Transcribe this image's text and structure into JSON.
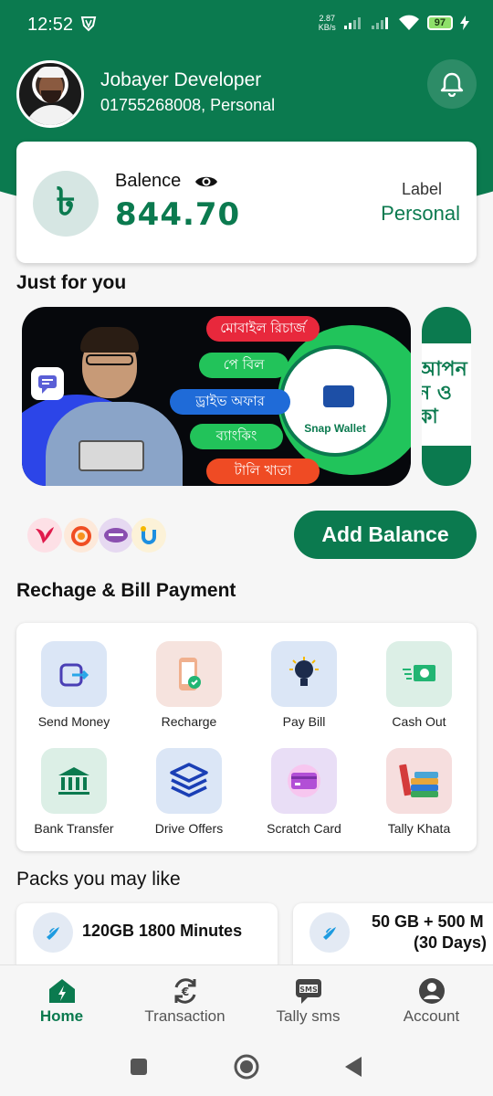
{
  "status_bar": {
    "time": "12:52",
    "net_speed_top": "2.87",
    "net_speed_bottom": "KB/s",
    "battery": "97"
  },
  "profile": {
    "name": "Jobayer Developer",
    "phone": "01755268008, Personal"
  },
  "balance": {
    "currency_symbol": "৳",
    "label": "Balence",
    "amount": "844.70",
    "account_label_title": "Label",
    "account_label_value": "Personal"
  },
  "sections": {
    "just_for_you": "Just for you",
    "recharge_bill": "Rechage & Bill Payment",
    "packs": "Packs you may like"
  },
  "banner": {
    "pills": [
      "মোবাইল রিচার্জ",
      "পে বিল",
      "ড্রাইভ অফার",
      "ব্যাংকিং",
      "টালি খাতা"
    ],
    "pill_colors": [
      "#e8283c",
      "#22c35a",
      "#1f6bd8",
      "#22c35a",
      "#ef4b24"
    ],
    "brand": "Snap Wallet",
    "second_banner_text": "আপন\nন ও \nকা"
  },
  "partners": [
    "bird-partner",
    "orange-partner",
    "purple-partner",
    "yellow-partner"
  ],
  "add_balance_label": "Add Balance",
  "services": [
    {
      "label": "Send Money",
      "icon": "send-money-icon",
      "bg": "#dbe6f6"
    },
    {
      "label": "Recharge",
      "icon": "recharge-icon",
      "bg": "#f6e3de"
    },
    {
      "label": "Pay Bill",
      "icon": "pay-bill-icon",
      "bg": "#dbe6f6"
    },
    {
      "label": "Cash Out",
      "icon": "cash-out-icon",
      "bg": "#dcefe6"
    },
    {
      "label": "Bank Transfer",
      "icon": "bank-icon",
      "bg": "#dcefe6"
    },
    {
      "label": "Drive Offers",
      "icon": "layers-icon",
      "bg": "#dbe6f6"
    },
    {
      "label": "Scratch Card",
      "icon": "scratch-card-icon",
      "bg": "#e9def6"
    },
    {
      "label": "Tally Khata",
      "icon": "books-icon",
      "bg": "#f6dede"
    }
  ],
  "packs": [
    {
      "title": "120GB 1800 Minutes"
    },
    {
      "title_line1": "50 GB + 500 M",
      "title_line2": "(30 Days)"
    }
  ],
  "bottom_nav": [
    {
      "label": "Home",
      "icon": "home-icon",
      "active": true
    },
    {
      "label": "Transaction",
      "icon": "transaction-icon",
      "active": false
    },
    {
      "label": "Tally sms",
      "icon": "sms-icon",
      "active": false
    },
    {
      "label": "Account",
      "icon": "account-icon",
      "active": false
    }
  ],
  "colors": {
    "primary": "#0b7a4f",
    "background": "#f6f6f6"
  }
}
